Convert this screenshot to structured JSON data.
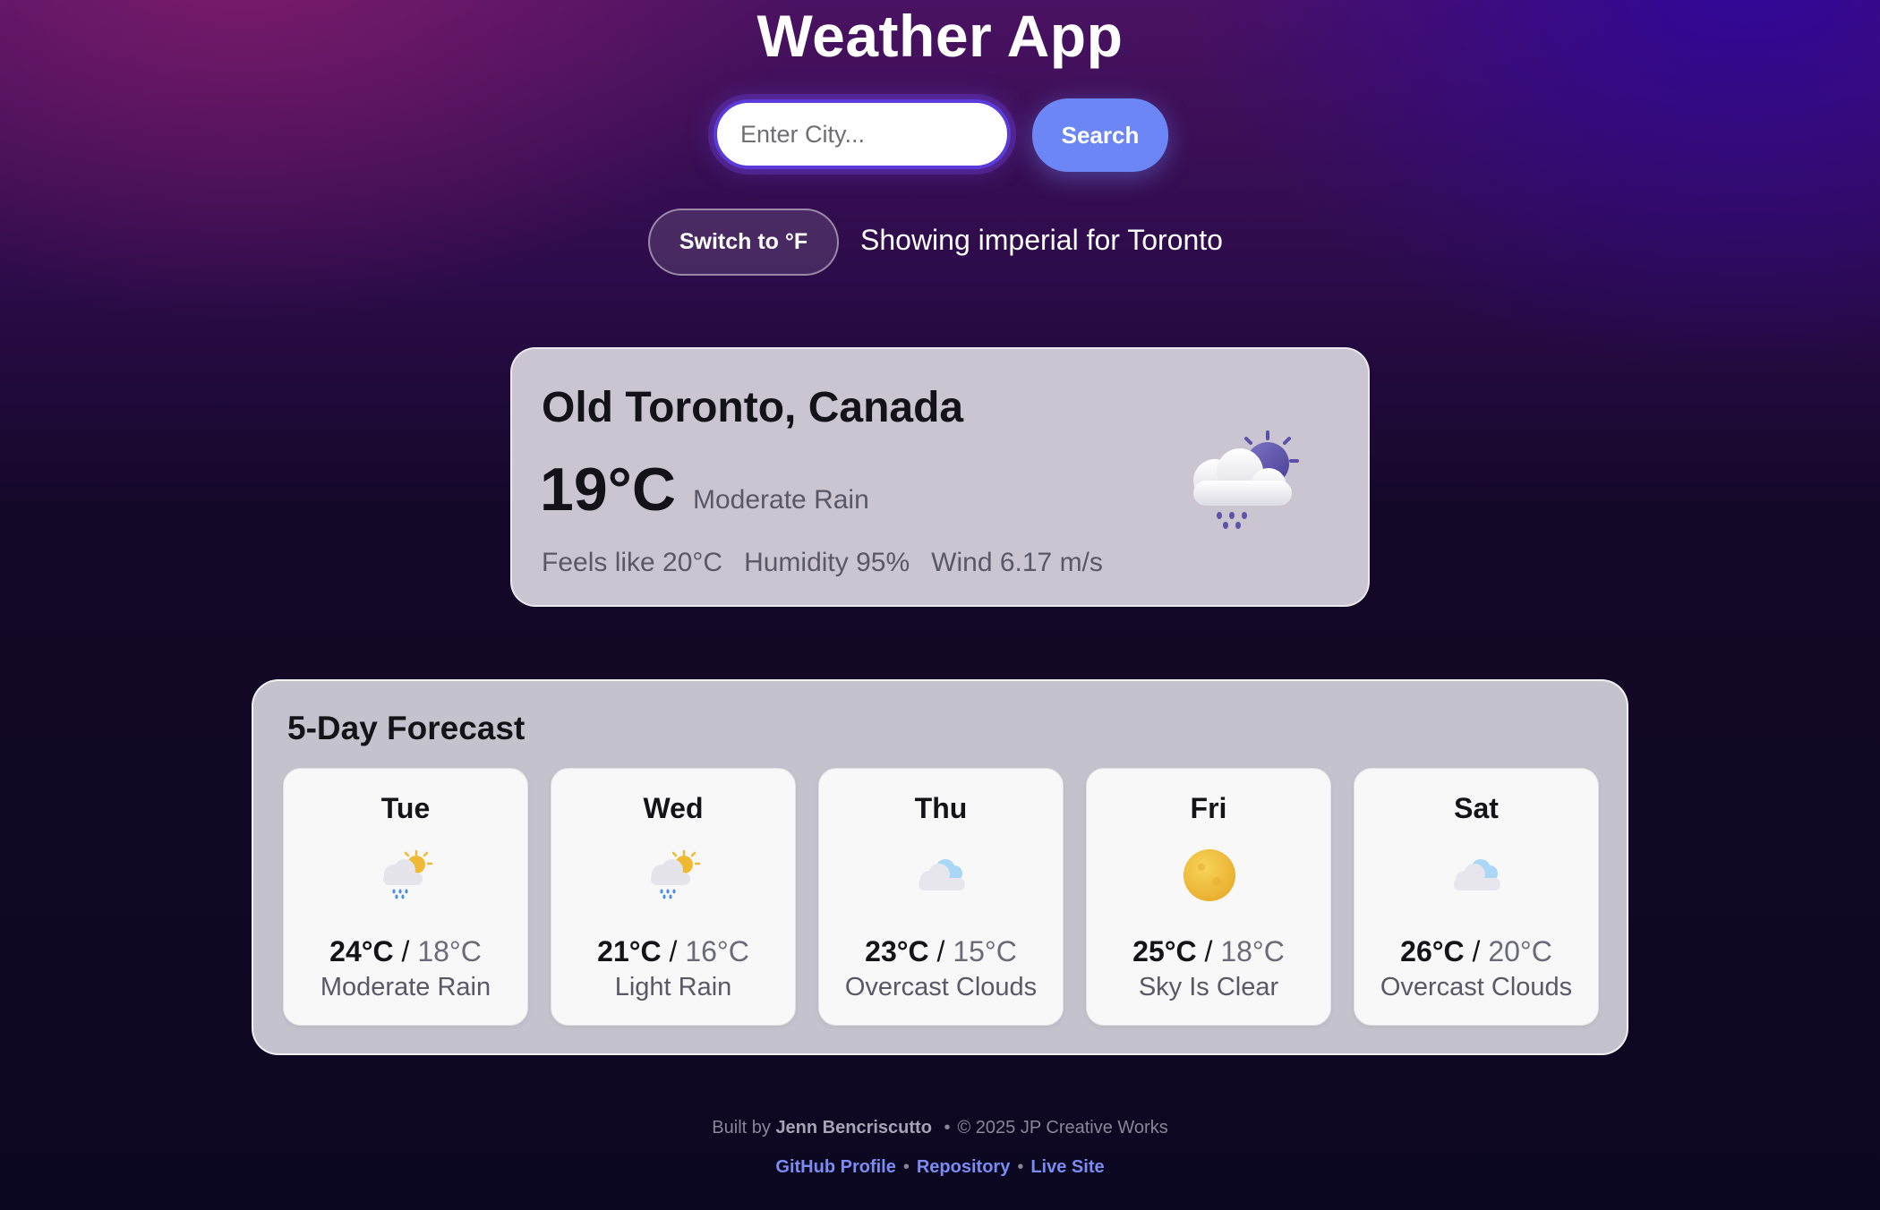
{
  "app": {
    "title": "Weather App"
  },
  "search": {
    "placeholder": "Enter City...",
    "value": "",
    "button_label": "Search"
  },
  "units": {
    "toggle_label": "Switch to °F",
    "status_text": "Showing imperial for Toronto"
  },
  "current": {
    "location": "Old Toronto, Canada",
    "temperature": "19°C",
    "description": "Moderate Rain",
    "feels_like": "Feels like 20°C",
    "humidity": "Humidity 95%",
    "wind": "Wind 6.17 m/s",
    "icon": "rain-cloud-moon-icon"
  },
  "forecast": {
    "title": "5-Day Forecast",
    "days": [
      {
        "day": "Tue",
        "high": "24°C",
        "low": "18°C",
        "description": "Moderate Rain",
        "icon": "sun-cloud-rain-icon"
      },
      {
        "day": "Wed",
        "high": "21°C",
        "low": "16°C",
        "description": "Light Rain",
        "icon": "sun-cloud-rain-icon"
      },
      {
        "day": "Thu",
        "high": "23°C",
        "low": "15°C",
        "description": "Overcast Clouds",
        "icon": "overcast-cloud-icon"
      },
      {
        "day": "Fri",
        "high": "25°C",
        "low": "18°C",
        "description": "Sky Is Clear",
        "icon": "sun-icon"
      },
      {
        "day": "Sat",
        "high": "26°C",
        "low": "20°C",
        "description": "Overcast Clouds",
        "icon": "overcast-cloud-icon"
      }
    ],
    "temp_separator": "/"
  },
  "footer": {
    "built_by_prefix": "Built by",
    "author": "Jenn Bencriscutto",
    "copyright": "© 2025 JP Creative Works",
    "separator": "•",
    "links": [
      "GitHub Profile",
      "Repository",
      "Live Site"
    ]
  },
  "colors": {
    "accent": "#6d86f5",
    "card_background": "#cbc5d1",
    "panel_background": "#c4c2cc",
    "link": "#7a8cf2"
  }
}
